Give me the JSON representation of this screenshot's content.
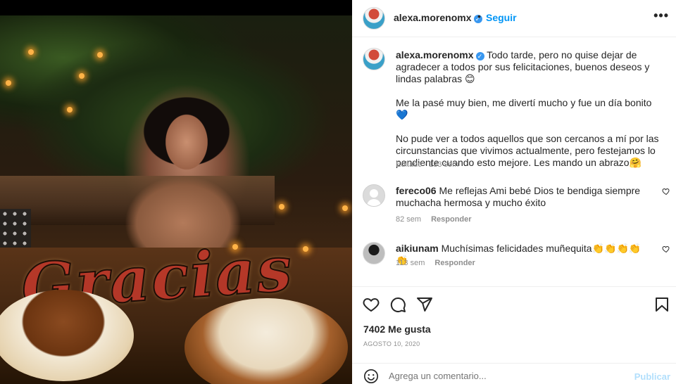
{
  "post": {
    "username": "alexa.morenomx",
    "follow_label": "Seguir",
    "separator": "•",
    "more_label": "•••",
    "verified_glyph": "✓",
    "photo_overlay_text": "Gracias"
  },
  "caption": {
    "username": "alexa.morenomx",
    "paragraph1": "Todo tarde, pero no quise dejar de agradecer a todos por sus felicitaciones, buenos deseos y lindas palabras 😊",
    "paragraph2": "Me la pasé muy bien, me divertí mucho y fue un día bonito 💙",
    "paragraph3": "No pude ver a todos aquellos que son cercanos a mí por las circunstancias que vivimos actualmente, pero festejamos lo pendiente cuando esto mejore. Les mando un abrazo🤗",
    "meta": "Editado · 133 sem"
  },
  "comments": [
    {
      "username": "fereco06",
      "text": "Me reflejas Ami bebé Dios te bendiga siempre muchacha hermosa y mucho éxito",
      "time": "82 sem",
      "reply_label": "Responder"
    },
    {
      "username": "aikiunam",
      "text": "Muchísimas felicidades muñequita👏👏👏👏👏",
      "time": "113 sem",
      "reply_label": "Responder"
    }
  ],
  "actions": {
    "likes": "7402 Me gusta",
    "date": "AGOSTO 10, 2020",
    "icons": [
      "heart-icon",
      "comment-icon",
      "share-icon",
      "bookmark-icon"
    ]
  },
  "composer": {
    "placeholder": "Agrega un comentario...",
    "post_label": "Publicar",
    "icon": "emoji-icon"
  },
  "colors": {
    "link_blue": "#0095f6",
    "verified_blue": "#3897f0",
    "muted": "#8e8e8e",
    "post_disabled": "#b2dffc"
  }
}
